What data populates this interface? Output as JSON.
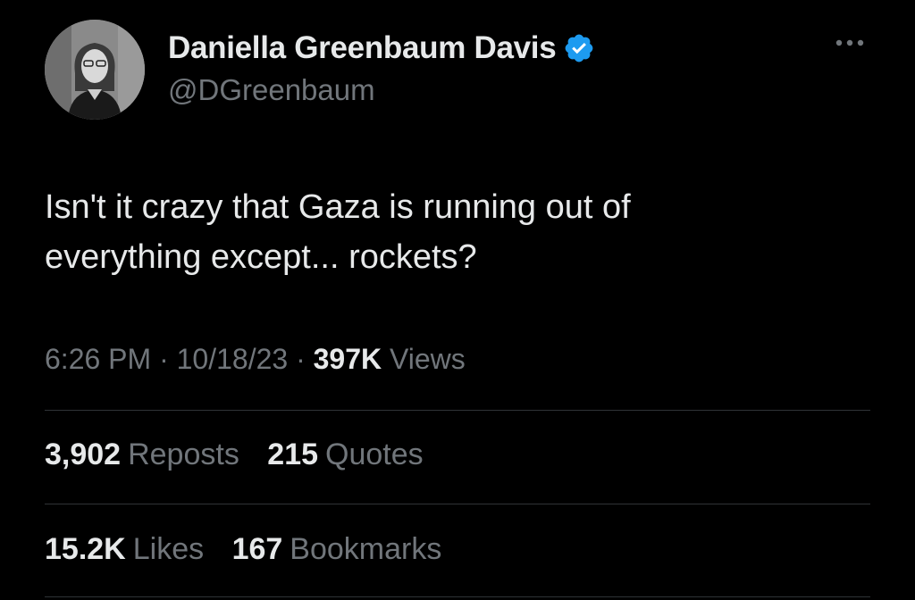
{
  "author": {
    "display_name": "Daniella Greenbaum Davis",
    "handle": "@DGreenbaum",
    "verified_icon": "verified-badge-icon",
    "verified_color": "#1d9bf0"
  },
  "more_icon": "more-options-icon",
  "tweet": {
    "text_lines": [
      "Isn't it crazy that Gaza is running out of",
      "everything except... rockets?"
    ]
  },
  "meta": {
    "time": "6:26 PM",
    "separator": "·",
    "date": "10/18/23",
    "views_count": "397K",
    "views_label": "Views"
  },
  "stats": {
    "reposts_count": "3,902",
    "reposts_label": "Reposts",
    "quotes_count": "215",
    "quotes_label": "Quotes",
    "likes_count": "15.2K",
    "likes_label": "Likes",
    "bookmarks_count": "167",
    "bookmarks_label": "Bookmarks"
  },
  "colors": {
    "background": "#000000",
    "primary_text": "#e7e9ea",
    "secondary_text": "#71767b",
    "divider": "#2f3336"
  }
}
